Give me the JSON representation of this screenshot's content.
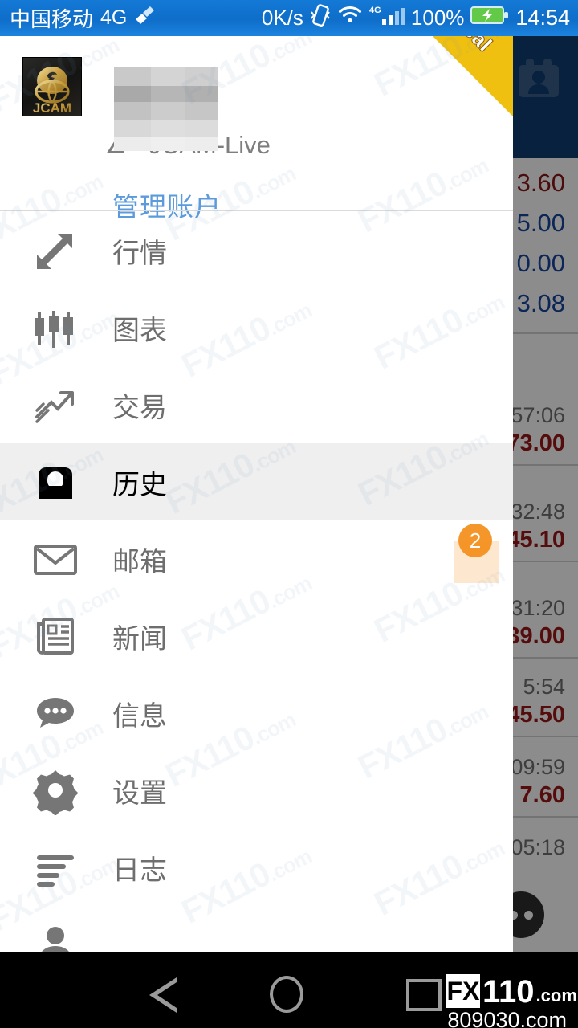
{
  "status_bar": {
    "carrier": "中国移动",
    "network_label": "4G",
    "broom_icon": "broom-icon",
    "data_speed": "0K/s",
    "vibrate_icon": "vibrate-icon",
    "wifi_icon": "wifi-icon",
    "signal_label": "4G",
    "signal_icon": "signal-bars-icon",
    "battery_percent": "100%",
    "battery_icon": "battery-charging-icon",
    "clock": "14:54"
  },
  "drawer": {
    "brand": {
      "logo_icon": "jcam-logo",
      "logo_text": "JCAM"
    },
    "account": {
      "name_censored": "",
      "suffix": "∠ - JCAM-Live",
      "manage_label": "管理账户",
      "ribbon_label": "Real",
      "ribbon_color": "#f0c010"
    },
    "menu": [
      {
        "label": "行情",
        "icon": "quotes-arrows-icon",
        "selected": false,
        "badge": ""
      },
      {
        "label": "图表",
        "icon": "candlestick-chart-icon",
        "selected": false,
        "badge": ""
      },
      {
        "label": "交易",
        "icon": "trade-trending-icon",
        "selected": false,
        "badge": ""
      },
      {
        "label": "历史",
        "icon": "history-inbox-icon",
        "selected": true,
        "badge": ""
      },
      {
        "label": "邮箱",
        "icon": "mailbox-envelope-icon",
        "selected": false,
        "badge": "2"
      },
      {
        "label": "新闻",
        "icon": "news-paper-icon",
        "selected": false,
        "badge": ""
      },
      {
        "label": "信息",
        "icon": "messages-chat-icon",
        "selected": false,
        "badge": ""
      },
      {
        "label": "设置",
        "icon": "settings-gear-icon",
        "selected": false,
        "badge": ""
      },
      {
        "label": "日志",
        "icon": "journal-lines-icon",
        "selected": false,
        "badge": ""
      },
      {
        "label": "",
        "icon": "accounts-person-icon",
        "selected": false,
        "badge": ""
      }
    ]
  },
  "app_underlay": {
    "toolbar_icon": "contacts-card-icon",
    "toolbar_color": "#0d3c73",
    "summary": [
      {
        "value": "3.60",
        "color": "#8c1616"
      },
      {
        "value": "5.00",
        "color": "#17469e"
      },
      {
        "value": "0.00",
        "color": "#17469e"
      },
      {
        "value": "3.08",
        "color": "#17469e"
      }
    ],
    "history": [
      {
        "time": "57:06",
        "value": "73.00"
      },
      {
        "time": "32:48",
        "value": "45.10"
      },
      {
        "time": "31:20",
        "value": "39.00"
      },
      {
        "time": "5:54",
        "value": "45.50"
      },
      {
        "time": "09:59",
        "value": "7.60"
      },
      {
        "time": "05:18",
        "value": ""
      }
    ],
    "fab_icon": "more-options-fab"
  },
  "watermark": {
    "text": "FX110",
    "suffix": ".com"
  },
  "nav_bar": {
    "back_icon": "nav-back-icon",
    "home_icon": "nav-home-icon",
    "recents_icon": "nav-recents-icon",
    "logo_mark": "FX",
    "logo_number": "110",
    "logo_tld": ".com",
    "url": "809030.com"
  }
}
